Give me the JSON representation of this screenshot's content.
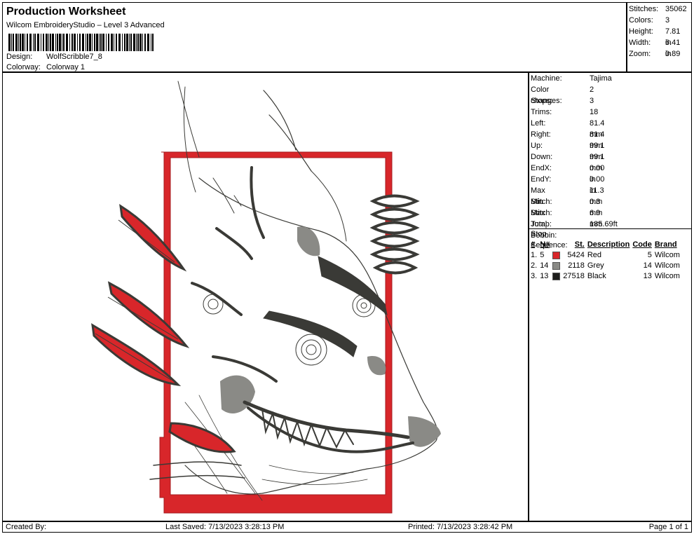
{
  "header": {
    "title": "Production Worksheet",
    "software": "Wilcom EmbroideryStudio – Level 3 Advanced",
    "design_label": "Design:",
    "design_value": "WolfScribble7_8",
    "colorway_label": "Colorway:",
    "colorway_value": "Colorway 1"
  },
  "stats": [
    {
      "label": "Stitches:",
      "value": "35062"
    },
    {
      "label": "Colors:",
      "value": "3"
    },
    {
      "label": "Height:",
      "value": "7.81 in"
    },
    {
      "label": "Width:",
      "value": "6.41 in"
    },
    {
      "label": "Zoom:",
      "value": "0.89"
    }
  ],
  "machine_info": [
    {
      "label": "Machine:",
      "value": "Tajima"
    },
    {
      "label": "Color changes:",
      "value": "2"
    },
    {
      "label": "Stops:",
      "value": "3"
    },
    {
      "label": "Trims:",
      "value": "18"
    },
    {
      "label": "Left:",
      "value": "81.4 mm"
    },
    {
      "label": "Right:",
      "value": "81.4 mm"
    },
    {
      "label": "Up:",
      "value": "99.1 mm"
    },
    {
      "label": "Down:",
      "value": "99.1 mm"
    },
    {
      "label": "EndX:",
      "value": "0.00 in"
    },
    {
      "label": "EndY:",
      "value": "0.00 in"
    },
    {
      "label": "Max Stitch:",
      "value": "11.3 mm"
    },
    {
      "label": "Min Stitch:",
      "value": "0.3 mm"
    },
    {
      "label": "Max Jump:",
      "value": "6.9 mm"
    },
    {
      "label": "Total Bobbin:",
      "value": "185.69ft"
    }
  ],
  "stop_sequence": {
    "title": "Stop Sequence:",
    "headers": [
      "#",
      "N#",
      "St.",
      "Description",
      "Code",
      "Brand"
    ],
    "rows": [
      {
        "index": "1.",
        "n": "5",
        "color": "#d8262a",
        "stitches": "5424",
        "description": "Red",
        "code": "5",
        "brand": "Wilcom"
      },
      {
        "index": "2.",
        "n": "14",
        "color": "#8a8a86",
        "stitches": "2118",
        "description": "Grey",
        "code": "14",
        "brand": "Wilcom"
      },
      {
        "index": "3.",
        "n": "13",
        "color": "#1e1e1c",
        "stitches": "27518",
        "description": "Black",
        "code": "13",
        "brand": "Wilcom"
      }
    ]
  },
  "footer": {
    "created_by": "Created By:",
    "last_saved": "Last Saved: 7/13/2023 3:28:13 PM",
    "printed": "Printed: 7/13/2023 3:28:42 PM",
    "page": "Page 1 of 1"
  },
  "colors": {
    "thread_red": "#d8262a",
    "thread_grey": "#8a8a86",
    "thread_black": "#3a3a36"
  }
}
